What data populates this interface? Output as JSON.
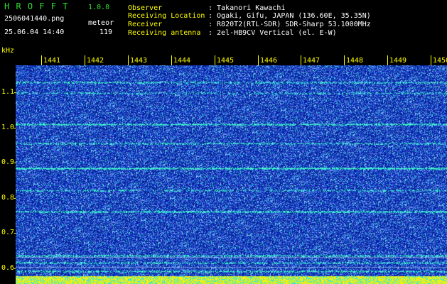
{
  "app": {
    "title": "H R O F F T",
    "version": "1.0.0",
    "filename": "2506041440.png",
    "mode": "meteor",
    "datetime": "25.06.04 14:40",
    "count": "119"
  },
  "info": {
    "observer_label": "Observer",
    "observer_value": ": Takanori Kawachi",
    "location_label": "Receiving Location",
    "location_value": ": Ogaki, Gifu, JAPAN (136.60E, 35.35N)",
    "receiver_label": "Receiver",
    "receiver_value": ": R820T2(RTL-SDR) SDR-Sharp 53.1000MHz",
    "antenna_label": "Receiving antenna",
    "antenna_value": ": 2el-HB9CV Vertical (el. E-W)"
  },
  "axis": {
    "y_unit": "kHz",
    "x_ticks": [
      "1441",
      "1442",
      "1443",
      "1444",
      "1445",
      "1446",
      "1447",
      "1448",
      "1449",
      "1450"
    ],
    "y_ticks": [
      "1.1",
      "1.0",
      "0.9",
      "0.8",
      "0.7",
      "0.6"
    ]
  },
  "colors": {
    "background": "#000000",
    "spectrum_base": "#0a1aa0",
    "noise_light": "#5f8cff",
    "signal": "#40ffd0",
    "axis": "#ffff00",
    "title": "#2fe02f"
  }
}
